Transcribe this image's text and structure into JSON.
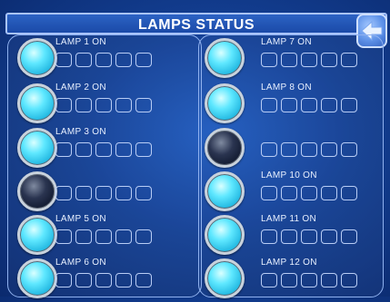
{
  "title": "LAMPS STATUS",
  "back_icon": "back-arrow-icon",
  "colors": {
    "on": "#3fd6f5",
    "off": "#0c1428",
    "accent": "#1b4aa8"
  },
  "left_lamps": [
    {
      "label": "LAMP 1  ON",
      "state": "on"
    },
    {
      "label": "LAMP 2  ON",
      "state": "on"
    },
    {
      "label": "LAMP 3  ON",
      "state": "on"
    },
    {
      "label": "",
      "state": "off"
    },
    {
      "label": "LAMP 5  ON",
      "state": "on"
    },
    {
      "label": "LAMP 6  ON",
      "state": "on"
    }
  ],
  "right_lamps": [
    {
      "label": "LAMP 7  ON",
      "state": "on"
    },
    {
      "label": "LAMP 8  ON",
      "state": "on"
    },
    {
      "label": "",
      "state": "off"
    },
    {
      "label": "LAMP 10  ON",
      "state": "on"
    },
    {
      "label": "LAMP 11  ON",
      "state": "on"
    },
    {
      "label": "LAMP 12  ON",
      "state": "on"
    }
  ]
}
